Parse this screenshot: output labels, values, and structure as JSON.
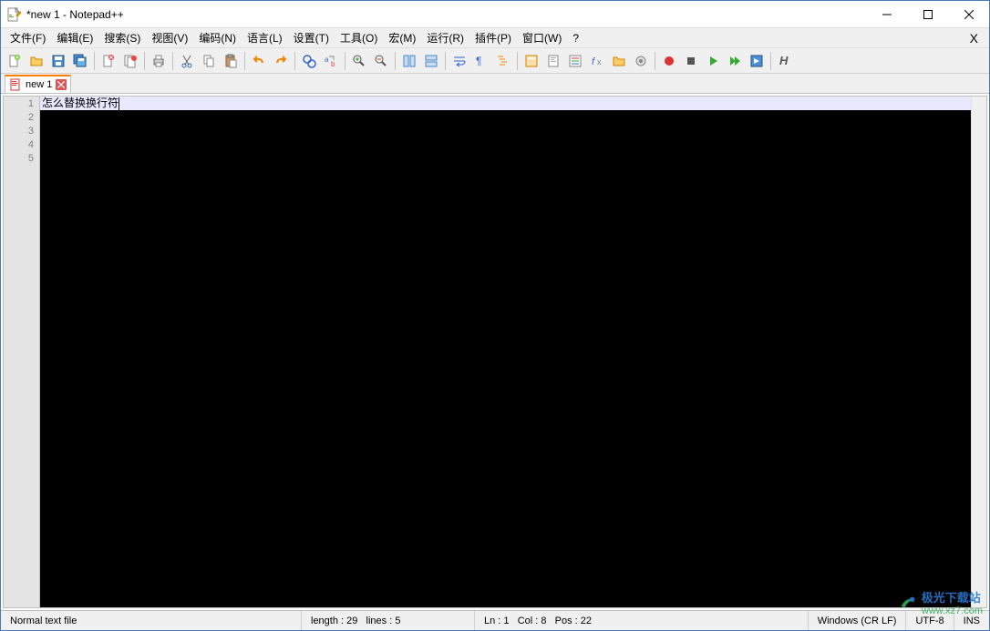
{
  "titlebar": {
    "title": "*new 1 - Notepad++"
  },
  "menu": {
    "file": "文件(F)",
    "edit": "编辑(E)",
    "search": "搜索(S)",
    "view": "视图(V)",
    "encoding": "编码(N)",
    "language": "语言(L)",
    "settings": "设置(T)",
    "tools": "工具(O)",
    "macro": "宏(M)",
    "run": "运行(R)",
    "plugins": "插件(P)",
    "window": "窗口(W)",
    "help": "?"
  },
  "tabs": [
    {
      "label": "new 1",
      "modified": true
    }
  ],
  "editor": {
    "lines": [
      "怎么替换换行符",
      "",
      "",
      "",
      ""
    ],
    "line_numbers": [
      "1",
      "2",
      "3",
      "4",
      "5"
    ],
    "cursor_line": 1
  },
  "status": {
    "filetype": "Normal text file",
    "length_label": "length : 29",
    "lines_label": "lines : 5",
    "ln_label": "Ln : 1",
    "col_label": "Col : 8",
    "pos_label": "Pos : 22",
    "eol": "Windows (CR LF)",
    "encoding": "UTF-8",
    "ins": "INS"
  },
  "watermark": {
    "name": "极光下载站",
    "url": "www.xz7.com"
  }
}
